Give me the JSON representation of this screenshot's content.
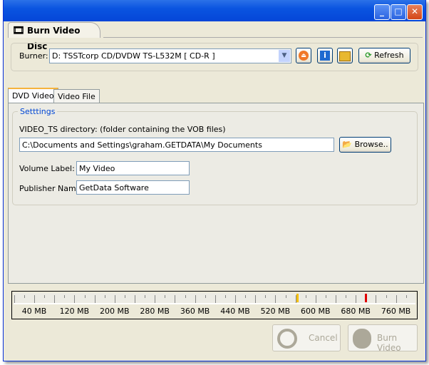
{
  "window": {
    "title": "",
    "controls": [
      "minimize",
      "maximize",
      "close"
    ]
  },
  "document_tab": {
    "title": "Burn Video Disc",
    "icon": "film-reel-icon"
  },
  "burner": {
    "label": "Burner:",
    "selected": "D: TSSTcorp CD/DVDW TS-L532M [ CD-R ]",
    "eject_icon": "eject-icon",
    "info_icon": "info-icon",
    "properties_icon": "folder-tools-icon",
    "refresh_label": "Refresh"
  },
  "tabs": [
    {
      "label": "DVD Video",
      "active": true
    },
    {
      "label": "Video File",
      "active": false
    }
  ],
  "settings": {
    "legend": "Setttings",
    "dir_label": "VIDEO_TS directory: (folder containing the VOB files)",
    "dir_value": "C:\\Documents and Settings\\graham.GETDATA\\My Documents",
    "browse_label": "Browse..",
    "volume_label": "Volume Label:",
    "volume_value": "My Video",
    "publisher_label": "Publisher Name:",
    "publisher_value": "GetData Software"
  },
  "ruler": {
    "labels": [
      "40 MB",
      "120 MB",
      "200 MB",
      "280 MB",
      "360 MB",
      "440 MB",
      "520 MB",
      "600 MB",
      "680 MB",
      "760 MB"
    ],
    "warning_marker_mb": 563,
    "capacity_marker_mb": 700,
    "colors": {
      "warning": "#f5c000",
      "capacity": "#e00000"
    }
  },
  "actions": {
    "cancel_label": "Cancel",
    "burn_label": "Burn Video"
  }
}
